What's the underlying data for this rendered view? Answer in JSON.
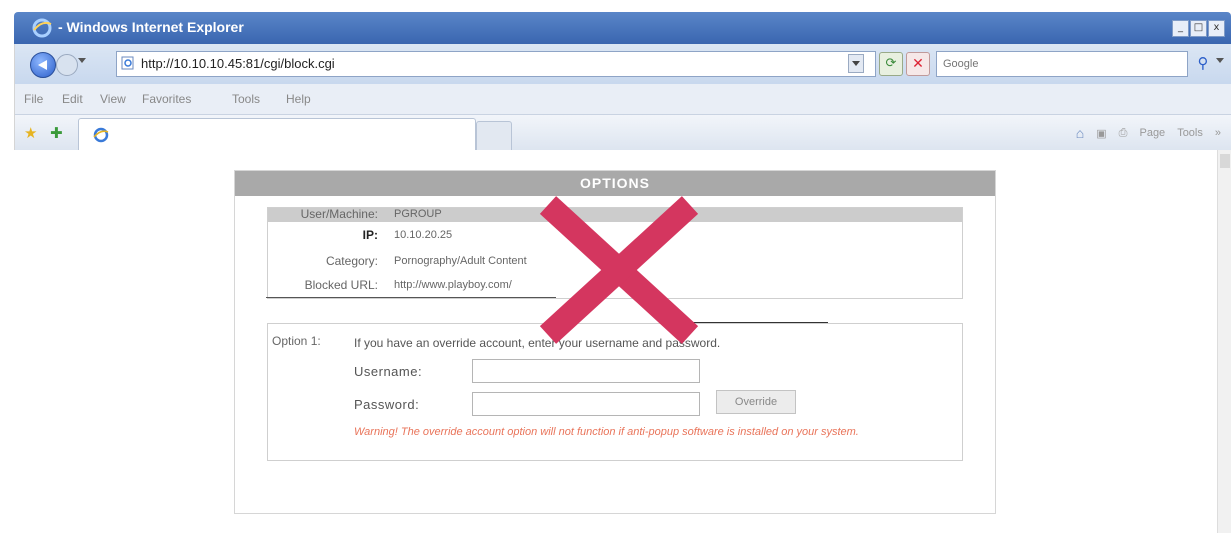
{
  "window": {
    "title": "- Windows Internet Explorer",
    "buttons": [
      "_",
      "□",
      "x"
    ]
  },
  "addressbar": {
    "url": "http://10.10.10.45:81/cgi/block.cgi",
    "search_placeholder": "Google"
  },
  "menu": {
    "items": [
      "File",
      "Edit",
      "View",
      "Favorites",
      "Tools",
      "Help"
    ]
  },
  "commandbar": {
    "page_label": "Page",
    "tools_label": "Tools",
    "more": "»"
  },
  "options": {
    "header": "OPTIONS",
    "info": {
      "user_label": "User/Machine:",
      "user_value": "PGROUP",
      "ip_label": "IP:",
      "ip_value": "10.10.20.25",
      "category_label": "Category:",
      "category_value": "Pornography/Adult Content",
      "url_label": "Blocked URL:",
      "url_value": "http://www.playboy.com/"
    },
    "option1": {
      "title": "Option 1:",
      "description": "If you have an override account, enter your username and password.",
      "username_label": "Username:",
      "password_label": "Password:",
      "override_button": "Override",
      "warning": "Warning! The override account option will not function if anti-popup software is installed on your system."
    }
  },
  "colors": {
    "title_bar": "#3a66b0",
    "panel_header": "#a9a9a9",
    "warning_text": "#e9745a",
    "x_mark": "#d4365f"
  }
}
